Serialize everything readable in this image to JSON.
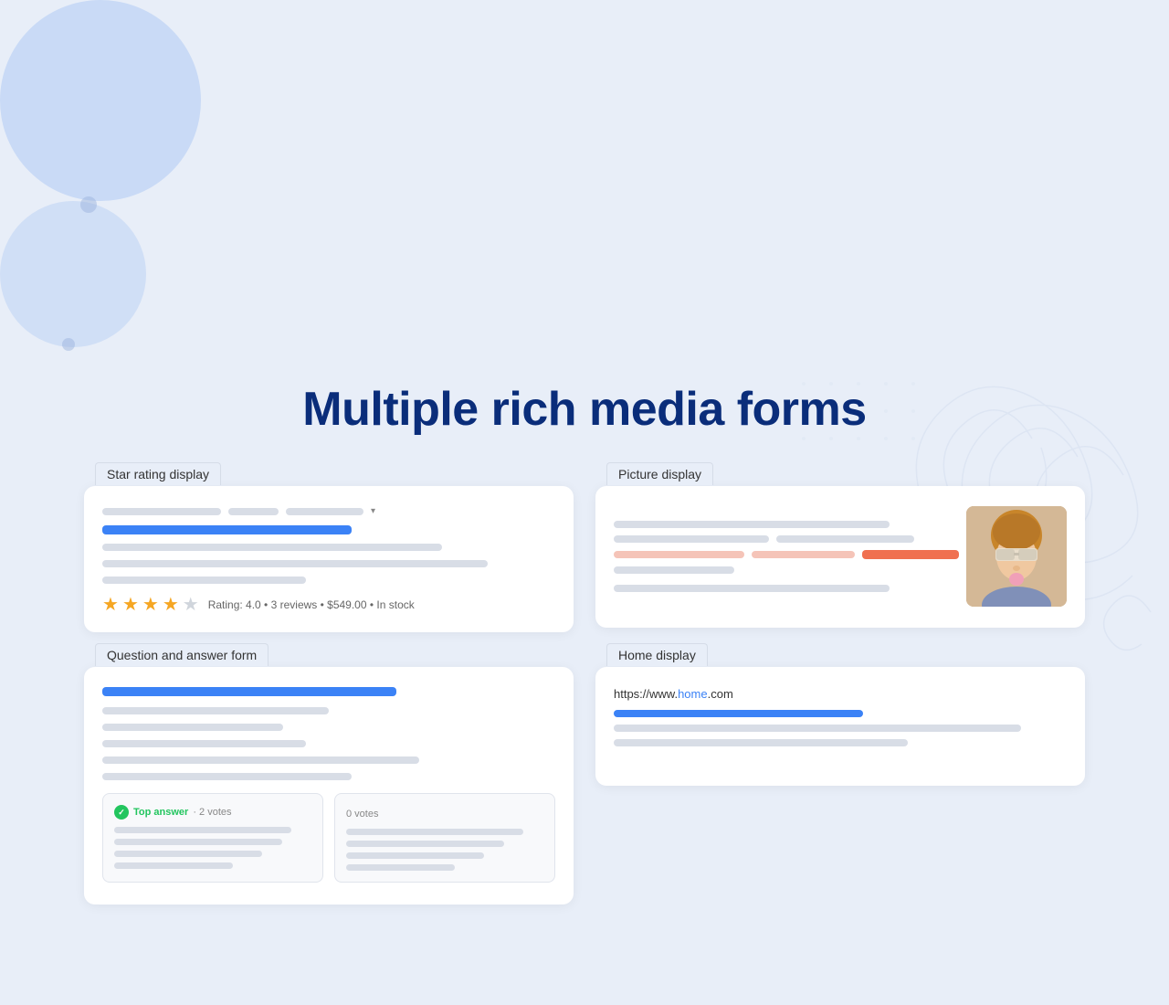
{
  "page": {
    "title": "Multiple rich media forms",
    "background_color": "#e8eef8"
  },
  "cards": {
    "star_rating": {
      "label": "Star rating display",
      "stars": [
        true,
        true,
        true,
        true,
        false
      ],
      "rating_text": "Rating: 4.0  •  3 reviews  •  $549.00  •  In stock"
    },
    "picture_display": {
      "label": "Picture display"
    },
    "qa_form": {
      "label": "Question and answer form",
      "answer1": {
        "badge": "Top answer",
        "votes": "2 votes"
      },
      "answer2": {
        "votes": "0 votes"
      }
    },
    "home_display": {
      "label": "Home display",
      "url_prefix": "https://www.",
      "url_domain": "home",
      "url_suffix": ".com"
    }
  }
}
